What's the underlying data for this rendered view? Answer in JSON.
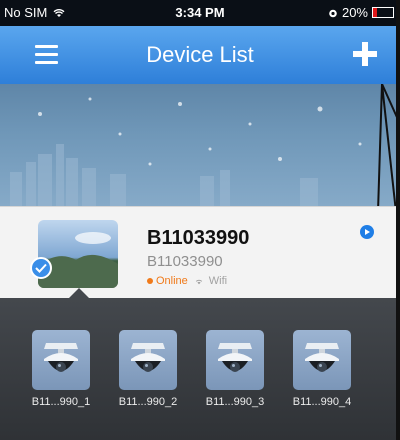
{
  "status_bar": {
    "carrier": "No SIM",
    "time": "3:34 PM",
    "battery": "20%",
    "battery_level": 0.2
  },
  "nav": {
    "title": "Device List",
    "menu_icon": "hamburger-menu-icon",
    "add_icon": "plus-icon"
  },
  "device": {
    "name": "B11033990",
    "id": "B11033990",
    "status": "Online",
    "connection": "Wifi",
    "status_color": "#f07a1a",
    "selected_icon": "check-icon",
    "play_icon": "play-icon"
  },
  "cameras": [
    {
      "label": "B11...990_1"
    },
    {
      "label": "B11...990_2"
    },
    {
      "label": "B11...990_3"
    },
    {
      "label": "B11...990_4"
    }
  ],
  "colors": {
    "nav_blue": "#2e7fd9",
    "accent_blue": "#1f7ee6",
    "strip_bg": "#3a3d41"
  }
}
